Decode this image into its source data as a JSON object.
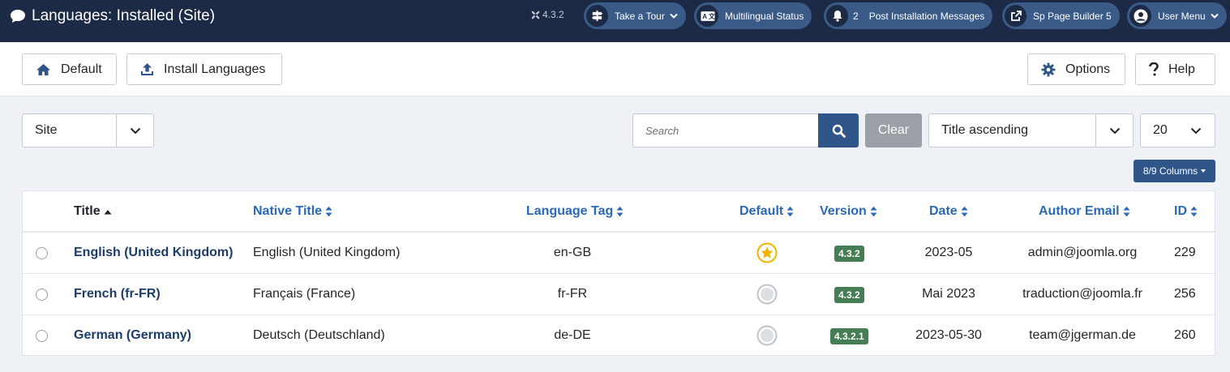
{
  "header": {
    "title": "Languages: Installed (Site)",
    "version": "4.3.2",
    "take_tour": "Take a Tour",
    "multilingual_status": "Multilingual Status",
    "post_install_count": "2",
    "post_install": "Post Installation Messages",
    "page_builder": "Sp Page Builder 5",
    "user_menu": "User Menu"
  },
  "toolbar": {
    "default_label": "Default",
    "install_label": "Install Languages",
    "options_label": "Options",
    "help_label": "Help"
  },
  "filters": {
    "client": "Site",
    "search_placeholder": "Search",
    "clear_label": "Clear",
    "ordering": "Title ascending",
    "limit": "20",
    "columns_label": "8/9 Columns"
  },
  "table": {
    "columns": {
      "title": "Title",
      "native_title": "Native Title",
      "language_tag": "Language Tag",
      "default": "Default",
      "version": "Version",
      "date": "Date",
      "author_email": "Author Email",
      "id": "ID"
    },
    "rows": [
      {
        "title": "English (United Kingdom)",
        "native_title": "English (United Kingdom)",
        "tag": "en-GB",
        "default": true,
        "version": "4.3.2",
        "date": "2023-05",
        "email": "admin@joomla.org",
        "id": "229"
      },
      {
        "title": "French (fr-FR)",
        "native_title": "Français (France)",
        "tag": "fr-FR",
        "default": false,
        "version": "4.3.2",
        "date": "Mai 2023",
        "email": "traduction@joomla.fr",
        "id": "256"
      },
      {
        "title": "German (Germany)",
        "native_title": "Deutsch (Deutschland)",
        "tag": "de-DE",
        "default": false,
        "version": "4.3.2.1",
        "date": "2023-05-30",
        "email": "team@jgerman.de",
        "id": "260"
      }
    ]
  },
  "colors": {
    "header_bg": "#1c2a45",
    "pill_bg": "#3a5a87",
    "primary": "#2f5589",
    "link": "#2a69b8",
    "badge_green": "#457d54",
    "star_gold": "#f0b400"
  }
}
